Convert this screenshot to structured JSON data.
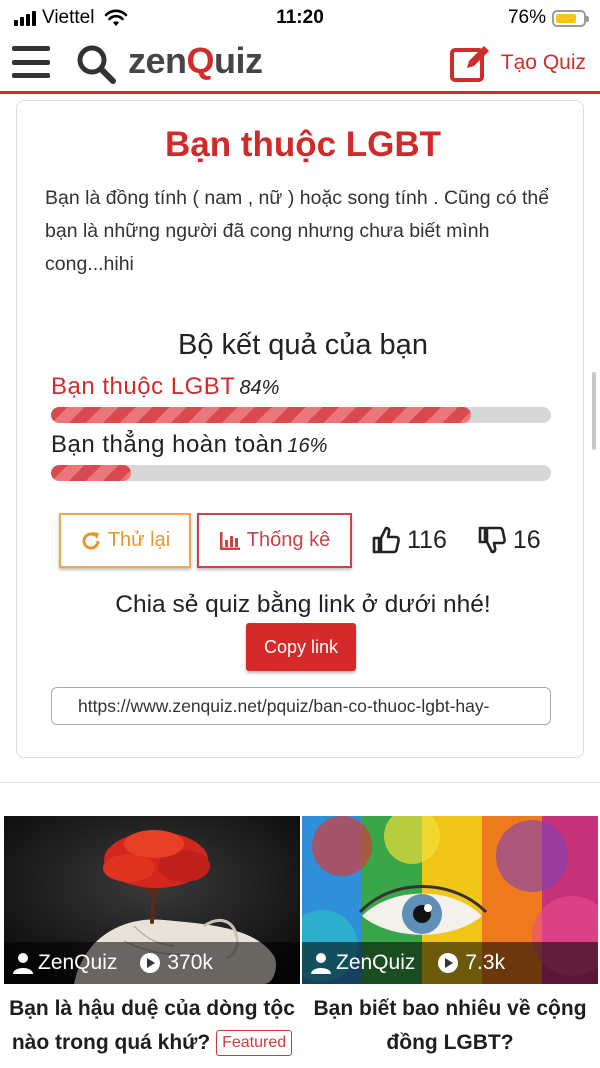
{
  "status_bar": {
    "carrier": "Viettel",
    "time": "11:20",
    "battery_percent": "76%",
    "battery_level": 0.76
  },
  "header": {
    "logo_prefix": "zen",
    "logo_q": "Q",
    "logo_suffix": "uiz",
    "create_quiz_label": "Tạo Quiz",
    "accent_color": "#d02c2c"
  },
  "result": {
    "title": "Bạn thuộc LGBT",
    "description": "Bạn là đồng tính ( nam , nữ ) hoặc song tính . Cũng có thể bạn là những người đã cong nhưng chưa biết mình cong...hihi",
    "set_heading": "Bộ kết quả của bạn",
    "items": [
      {
        "label": "Bạn thuộc LGBT",
        "percent_text": "84%",
        "value": 84
      },
      {
        "label": "Bạn thẳng hoàn toàn",
        "percent_text": "16%",
        "value": 16
      }
    ],
    "retry_label": "Thử lại",
    "stats_label": "Thống kê",
    "likes": "116",
    "dislikes": "16",
    "share_text": "Chia sẻ quiz bằng link ở dưới nhé!",
    "copy_label": "Copy link",
    "share_url": "https://www.zenquiz.net/pquiz/ban-co-thuoc-lgbt-hay-"
  },
  "related": [
    {
      "author": "ZenQuiz",
      "views": "370k",
      "title": "Bạn là hậu duệ của dòng tộc nào trong quá khứ?",
      "badge": "Featured"
    },
    {
      "author": "ZenQuiz",
      "views": "7.3k",
      "title": "Bạn biết bao nhiêu về cộng đồng LGBT?"
    }
  ]
}
